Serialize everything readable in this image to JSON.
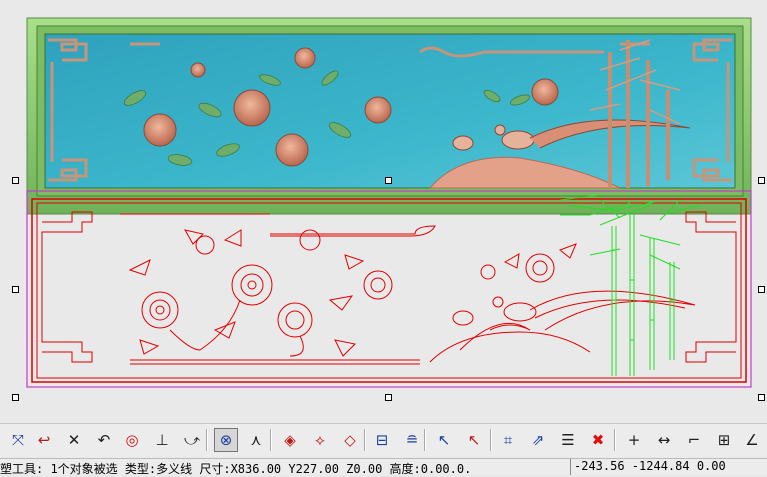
{
  "toolbar": {
    "buttons": [
      {
        "name": "snap-cross-icon",
        "glyph": "⤧",
        "color": "#1a3fa0"
      },
      {
        "name": "snap-endpoint-icon",
        "glyph": "↩",
        "color": "#b02020"
      },
      {
        "name": "snap-intersection-icon",
        "glyph": "✕",
        "color": "#202020"
      },
      {
        "name": "snap-arc-icon",
        "glyph": "↶",
        "color": "#202020"
      },
      {
        "name": "snap-circle-center-icon",
        "glyph": "◎",
        "color": "#d01010"
      },
      {
        "name": "snap-perpendicular-icon",
        "glyph": "⊥",
        "color": "#202020"
      },
      {
        "name": "snap-tangent-icon",
        "glyph": "⤻",
        "color": "#202020"
      },
      {
        "name": "snap-node-icon",
        "glyph": "⊗",
        "color": "#1a3fa0"
      },
      {
        "name": "snap-angle-icon",
        "glyph": "⋏",
        "color": "#202020"
      },
      {
        "name": "view-diamond-icon",
        "glyph": "◈",
        "color": "#c01818"
      },
      {
        "name": "view-diamond-x-icon",
        "glyph": "⟡",
        "color": "#c01818"
      },
      {
        "name": "view-diamond-dot-icon",
        "glyph": "◇",
        "color": "#c01818"
      },
      {
        "name": "layer-align-icon",
        "glyph": "⊟",
        "color": "#1a3fa0"
      },
      {
        "name": "layer-stack-icon",
        "glyph": "≘",
        "color": "#1a3fa0"
      },
      {
        "name": "select-cursor-icon",
        "glyph": "↖",
        "color": "#1a3fa0"
      },
      {
        "name": "deselect-cursor-icon",
        "glyph": "↖",
        "color": "#c01818"
      },
      {
        "name": "transform-grid-icon",
        "glyph": "⌗",
        "color": "#1a3fa0"
      },
      {
        "name": "transform-arrows-icon",
        "glyph": "⇗",
        "color": "#1a3fa0"
      },
      {
        "name": "list-edit-icon",
        "glyph": "☰",
        "color": "#202020"
      },
      {
        "name": "delete-icon",
        "glyph": "✖",
        "color": "#e01010"
      },
      {
        "name": "crosshair-icon",
        "glyph": "+",
        "color": "#202020"
      },
      {
        "name": "measure-horizontal-icon",
        "glyph": "↔",
        "color": "#202020"
      },
      {
        "name": "corner-icon",
        "glyph": "⌐",
        "color": "#202020"
      },
      {
        "name": "frame-measure-icon",
        "glyph": "⊞",
        "color": "#202020"
      },
      {
        "name": "angle-measure-icon",
        "glyph": "∠",
        "color": "#202020"
      }
    ]
  },
  "status": {
    "main": "塑工具: 1个对象被选 类型:多义线 尺寸:X836.00 Y227.00 Z0.00 高度:0.00.0.",
    "coords": "-243.56 -1244.84 0.00"
  },
  "colors": {
    "relief_frame": "#8fcf72",
    "relief_sky": "#3fb4c8",
    "vector_lines": "#e00000",
    "bamboo_lines": "#22dd22",
    "selection_box": "#c23cc8"
  }
}
